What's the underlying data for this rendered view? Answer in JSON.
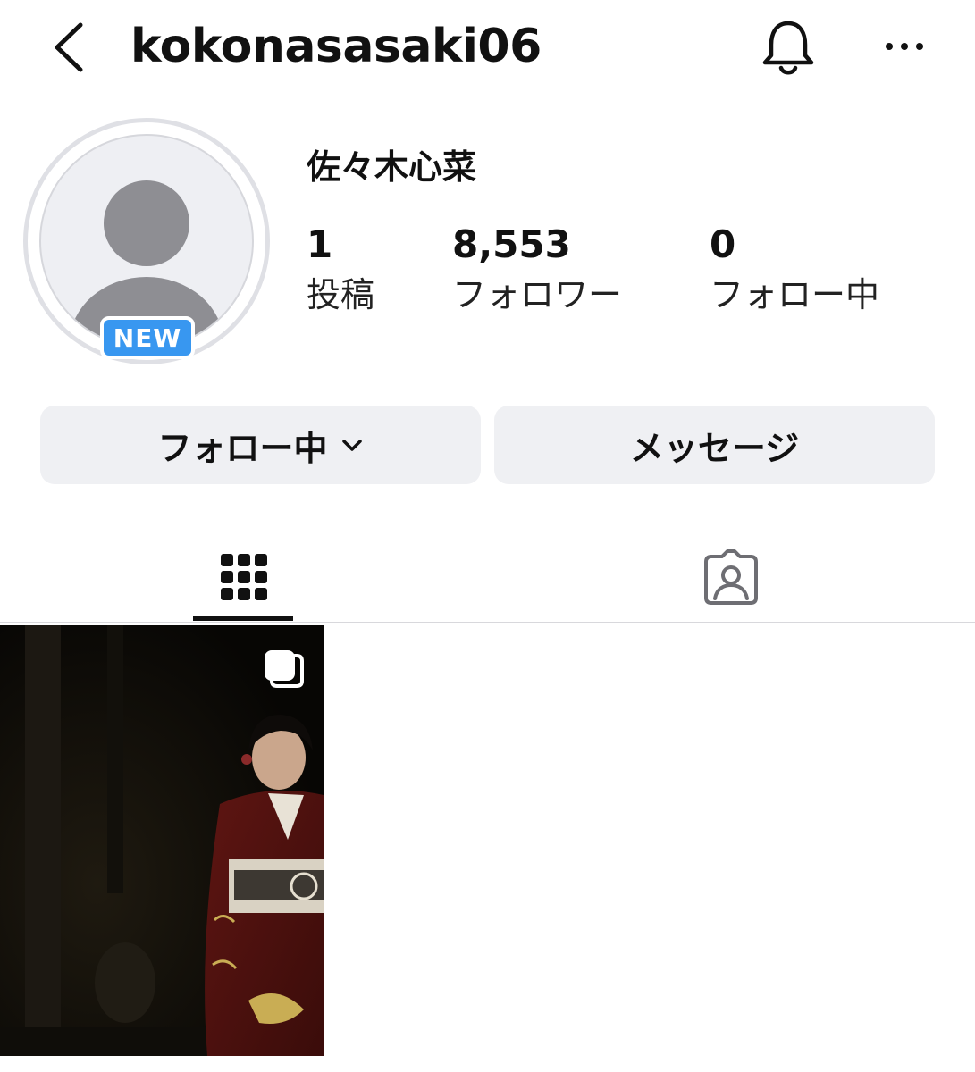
{
  "header": {
    "username": "kokonasasaki06",
    "back_icon": "chevron-left-icon",
    "bell_icon": "bell-icon",
    "more_icon": "more-horizontal-icon"
  },
  "profile": {
    "display_name": "佐々木心菜",
    "avatar_icon": "default-avatar-icon",
    "new_badge": "NEW",
    "stats": [
      {
        "value": "1",
        "label": "投稿"
      },
      {
        "value": "8,553",
        "label": "フォロワー"
      },
      {
        "value": "0",
        "label": "フォロー中"
      }
    ]
  },
  "actions": {
    "following_label": "フォロー中",
    "message_label": "メッセージ"
  },
  "tabs": {
    "active": "grid",
    "items": [
      {
        "id": "grid",
        "icon": "grid-icon"
      },
      {
        "id": "tagged",
        "icon": "tagged-person-icon"
      }
    ]
  },
  "posts": [
    {
      "type": "carousel",
      "icon": "multiple-images-icon"
    }
  ],
  "colors": {
    "badge_blue": "#3897f0",
    "button_bg": "#eff0f3",
    "avatar_gray": "#8e8e93"
  }
}
